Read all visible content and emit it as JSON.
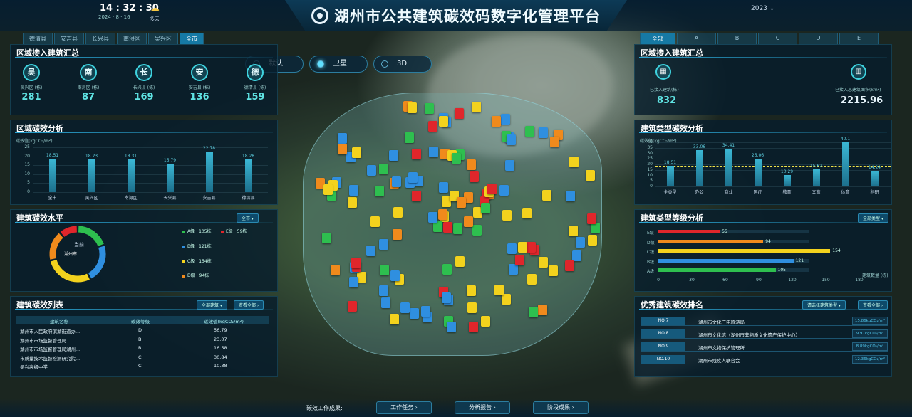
{
  "header": {
    "time": "14 : 32 : 30",
    "date": "2024 · 8 · 16",
    "weather": "多云",
    "title": "湖州市公共建筑碳效码数字化管理平台",
    "year": "2023",
    "year_arrow": "⌄"
  },
  "left_tabs": [
    "德清县",
    "安吉县",
    "长兴县",
    "南浔区",
    "吴兴区",
    "全市"
  ],
  "right_tabs": [
    "全部",
    "A",
    "B",
    "C",
    "D",
    "E"
  ],
  "view_buttons": [
    "默认",
    "卫星",
    "3D"
  ],
  "region_summary": {
    "title": "区域接入建筑汇总",
    "districts": [
      {
        "char": "吴",
        "label": "吴兴区 (栋)",
        "value": "281"
      },
      {
        "char": "南",
        "label": "南浔区 (栋)",
        "value": "87"
      },
      {
        "char": "长",
        "label": "长兴县 (栋)",
        "value": "169"
      },
      {
        "char": "安",
        "label": "安吉县 (栋)",
        "value": "136"
      },
      {
        "char": "德",
        "label": "德清县 (栋)",
        "value": "159"
      }
    ]
  },
  "region_efficiency": {
    "title": "区域碳效分析",
    "unit": "碳效值(kgCO₂/m²)"
  },
  "chart_data": [
    {
      "type": "bar",
      "title": "区域碳效分析",
      "ylabel": "碳效值(kgCO₂/m²)",
      "ylim": [
        0,
        25
      ],
      "yticks": [
        "25",
        "20",
        "15",
        "10",
        "5",
        "0"
      ],
      "categories": [
        "全市",
        "吴兴区",
        "南浔区",
        "长兴县",
        "安吉县",
        "德清县"
      ],
      "value_labels": [
        "18.51",
        "18.23",
        "18.31",
        "15.79",
        "22.78",
        "18.28"
      ],
      "values": [
        18.51,
        18.23,
        18.31,
        15.79,
        22.78,
        18.28
      ]
    },
    {
      "type": "bar",
      "title": "建筑类型碳效分析",
      "ylabel": "碳效值(kgCO₂/m²)",
      "ylim": [
        0,
        40
      ],
      "yticks": [
        "40",
        "35",
        "30",
        "25",
        "20",
        "15",
        "10",
        "5",
        "0"
      ],
      "categories": [
        "全类型",
        "办公",
        "商业",
        "医疗",
        "教育",
        "文旅",
        "体育",
        "科研"
      ],
      "value_labels": [
        "18.51",
        "33.06",
        "34.41",
        "25.06",
        "10.29",
        "15.62",
        "40.1",
        "14.24"
      ],
      "values": [
        18.51,
        33.06,
        34.41,
        25.06,
        10.29,
        15.62,
        40.1,
        14.24
      ]
    },
    {
      "type": "bar",
      "title": "建筑类型等级分析",
      "categories": [
        "E级",
        "D级",
        "C级",
        "B级",
        "A级"
      ],
      "values": [
        55,
        94,
        154,
        121,
        105
      ],
      "xlim": [
        0,
        180
      ],
      "xticks": [
        "0",
        "30",
        "60",
        "90",
        "120",
        "150",
        "180"
      ],
      "xlabel": "建筑数量 (栋)",
      "colors": [
        "#e0262b",
        "#f08a1c",
        "#f3d21d",
        "#2f8fe0",
        "#2ebf4f"
      ]
    },
    {
      "type": "pie",
      "title": "建筑碳效水平",
      "center_label": "当前",
      "center_value": "湖州市",
      "slices": [
        {
          "label": "A级",
          "value": 105,
          "text": "105栋",
          "color": "#2ebf4f"
        },
        {
          "label": "B级",
          "value": 121,
          "text": "121栋",
          "color": "#2f8fe0"
        },
        {
          "label": "C级",
          "value": 154,
          "text": "154栋",
          "color": "#f3d21d"
        },
        {
          "label": "D级",
          "value": 94,
          "text": "94栋",
          "color": "#f08a1c"
        },
        {
          "label": "E级",
          "value": 59,
          "text": "59栋",
          "color": "#e0262b"
        }
      ]
    }
  ],
  "level_panel": {
    "title": "建筑碳效水平",
    "dropdown": "全市"
  },
  "type_panel": {
    "title": "建筑类型碳效分析"
  },
  "grade_panel": {
    "title": "建筑类型等级分析",
    "dropdown": "全部类型"
  },
  "list_panel": {
    "title": "建筑碳效列表",
    "dropdown": "全部建筑",
    "more": "查看全部",
    "headers": [
      "建筑名称",
      "碳效等级",
      "碳效值(kgCO₂/m²)"
    ],
    "rows": [
      [
        "湖州市人民政府滨湖街道办...",
        "D",
        "56.79"
      ],
      [
        "湖州市市场监督管理局",
        "B",
        "23.07"
      ],
      [
        "湖州市市场监督管理局湖州...",
        "B",
        "16.58"
      ],
      [
        "市质量技术监督检测研究院...",
        "C",
        "30.84"
      ],
      [
        "吴兴高级中学",
        "C",
        "10.38"
      ]
    ]
  },
  "right_summary": {
    "title": "区域接入建筑汇总",
    "a_label": "已接入建筑(栋)",
    "a_value": "832",
    "b_label": "已接入总建筑面积(km²)",
    "b_value": "2215.96"
  },
  "ranking_panel": {
    "title": "优秀建筑碳效排名",
    "filter": "请选择建筑类型",
    "more": "查看全部",
    "rows": [
      {
        "no": "NO.7",
        "name": "湖州市文化广电旅游局",
        "value": "15.86kgCO₂/m²"
      },
      {
        "no": "NO.8",
        "name": "湖州市文化馆（湖州市非物质文化遗产保护中心）",
        "value": "9.97kgCO₂/m²"
      },
      {
        "no": "NO.9",
        "name": "湖州市文物保护管理所",
        "value": "8.89kgCO₂/m²"
      },
      {
        "no": "NO.10",
        "name": "湖州市残疾人联合会",
        "value": "12.36kgCO₂/m²"
      }
    ]
  },
  "bottom": {
    "label": "碳效工作成果:",
    "buttons": [
      "工作任务",
      "分析报告",
      "阶段成果"
    ],
    "arrow": "›"
  }
}
